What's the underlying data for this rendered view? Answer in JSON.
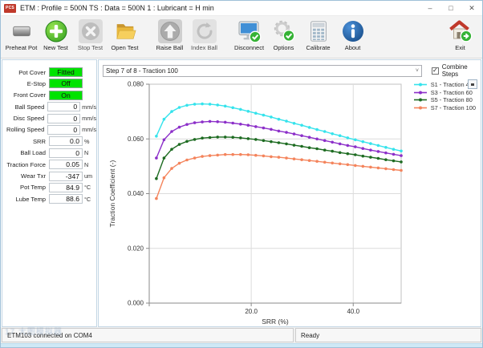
{
  "window": {
    "title": "ETM : Profile = 500N TS : Data = 500N 1 : Lubricant = H min",
    "app_icon_label": "PCS",
    "controls": {
      "minimize": "–",
      "maximize": "□",
      "close": "✕"
    }
  },
  "toolbar": {
    "buttons": [
      {
        "name": "preheat-pot",
        "label": "Preheat Pot",
        "icon": "preheat-pot-icon"
      },
      {
        "name": "new-test",
        "label": "New Test",
        "icon": "new-test-icon"
      },
      {
        "name": "stop-test",
        "label": "Stop Test",
        "icon": "stop-test-icon",
        "disabled": true
      },
      {
        "name": "open-test",
        "label": "Open Test",
        "icon": "open-test-icon"
      },
      {
        "name": "raise-ball",
        "label": "Raise Ball",
        "icon": "raise-ball-icon",
        "gap_before": true
      },
      {
        "name": "index-ball",
        "label": "Index Ball",
        "icon": "index-ball-icon",
        "disabled": true
      },
      {
        "name": "disconnect",
        "label": "Disconnect",
        "icon": "disconnect-icon",
        "gap_before": true
      },
      {
        "name": "options",
        "label": "Options",
        "icon": "options-icon"
      },
      {
        "name": "calibrate",
        "label": "Calibrate",
        "icon": "calibrate-icon"
      },
      {
        "name": "about",
        "label": "About",
        "icon": "about-icon"
      },
      {
        "name": "exit",
        "label": "Exit",
        "icon": "exit-icon",
        "align": "right"
      }
    ]
  },
  "status_panel": {
    "rows": [
      {
        "label": "Pot Cover",
        "value": "Fitted",
        "unit": "",
        "style": "green"
      },
      {
        "label": "E-Stop",
        "value": "Off",
        "unit": "",
        "style": "green"
      },
      {
        "label": "Front Cover",
        "value": "On",
        "unit": "",
        "style": "green"
      },
      {
        "label": "Ball Speed",
        "value": "0",
        "unit": "mm/s",
        "style": "plain"
      },
      {
        "label": "Disc Speed",
        "value": "0",
        "unit": "mm/s",
        "style": "plain"
      },
      {
        "label": "Rolling Speed",
        "value": "0",
        "unit": "mm/s",
        "style": "plain"
      },
      {
        "label": "SRR",
        "value": "0.0",
        "unit": "%",
        "style": "plain"
      },
      {
        "label": "Ball Load",
        "value": "0",
        "unit": "N",
        "style": "plain"
      },
      {
        "label": "Traction Force",
        "value": "0.05",
        "unit": "N",
        "style": "plain"
      },
      {
        "label": "Wear Txr",
        "value": "-347",
        "unit": "um",
        "style": "plain"
      },
      {
        "label": "Pot Temp",
        "value": "84.9",
        "unit": "°C",
        "style": "plain"
      },
      {
        "label": "Lube Temp",
        "value": "88.6",
        "unit": "°C",
        "style": "plain"
      }
    ]
  },
  "chart_panel": {
    "step_selector": "Step 7 of 8 - Traction 100",
    "combine_steps_label": "Combine Steps",
    "combine_steps_checked": true,
    "check_glyph": "✓",
    "chevron_glyph": "˅"
  },
  "chart_data": {
    "type": "line",
    "title": "",
    "xlabel": "SRR (%)",
    "ylabel": "Traction Coefficient (-)",
    "xlim": [
      0,
      49.4
    ],
    "ylim": [
      0,
      0.08
    ],
    "x_ticks": [
      0,
      20.0,
      40.0
    ],
    "x_tick_labels": [
      "",
      "20.0",
      "40.0"
    ],
    "y_ticks": [
      0.0,
      0.02,
      0.04,
      0.06,
      0.08
    ],
    "grid": true,
    "legend_position": "top-right-outside",
    "x": [
      1.4,
      2.9,
      4.4,
      5.9,
      7.4,
      8.9,
      10.4,
      11.9,
      13.4,
      14.9,
      16.4,
      17.9,
      19.4,
      20.9,
      22.4,
      23.9,
      25.4,
      26.9,
      28.4,
      29.9,
      31.4,
      32.9,
      34.4,
      35.9,
      37.4,
      38.9,
      40.4,
      41.9,
      43.4,
      44.9,
      46.4,
      47.9,
      49.4
    ],
    "series": [
      {
        "name": "S1 - Traction 40",
        "color": "#35e3ec",
        "values": [
          0.061,
          0.0672,
          0.07,
          0.0715,
          0.0723,
          0.0727,
          0.0728,
          0.0727,
          0.0724,
          0.072,
          0.0714,
          0.0708,
          0.0701,
          0.0694,
          0.0687,
          0.068,
          0.0672,
          0.0665,
          0.0657,
          0.065,
          0.0642,
          0.0634,
          0.0627,
          0.0619,
          0.0612,
          0.0604,
          0.0597,
          0.059,
          0.0583,
          0.0576,
          0.0569,
          0.0562,
          0.0556
        ]
      },
      {
        "name": "S3 - Traction 60",
        "color": "#8c2fc9",
        "values": [
          0.053,
          0.0597,
          0.0627,
          0.0643,
          0.0653,
          0.0659,
          0.0662,
          0.0664,
          0.0663,
          0.0661,
          0.0658,
          0.0654,
          0.065,
          0.0645,
          0.064,
          0.0635,
          0.0629,
          0.0624,
          0.0618,
          0.0612,
          0.0606,
          0.06,
          0.0594,
          0.0588,
          0.0582,
          0.0576,
          0.0571,
          0.0565,
          0.0559,
          0.0554,
          0.0549,
          0.0544,
          0.0539
        ]
      },
      {
        "name": "S5 - Traction 80",
        "color": "#1d6b21",
        "values": [
          0.0455,
          0.053,
          0.0562,
          0.058,
          0.0591,
          0.0598,
          0.0603,
          0.0605,
          0.0607,
          0.0607,
          0.0606,
          0.0604,
          0.0601,
          0.0598,
          0.0594,
          0.059,
          0.0586,
          0.0582,
          0.0577,
          0.0573,
          0.0568,
          0.0564,
          0.0559,
          0.0555,
          0.055,
          0.0546,
          0.0542,
          0.0537,
          0.0533,
          0.0529,
          0.0524,
          0.052,
          0.0516
        ]
      },
      {
        "name": "S7 - Traction 100",
        "color": "#f4845c",
        "values": [
          0.0382,
          0.0458,
          0.0492,
          0.0511,
          0.0523,
          0.053,
          0.0536,
          0.0539,
          0.0541,
          0.0543,
          0.0543,
          0.0543,
          0.0542,
          0.054,
          0.0538,
          0.0535,
          0.0533,
          0.053,
          0.0527,
          0.0524,
          0.0521,
          0.0518,
          0.0515,
          0.0512,
          0.0509,
          0.0506,
          0.0503,
          0.05,
          0.0497,
          0.0494,
          0.0491,
          0.0488,
          0.0485
        ]
      }
    ]
  },
  "status_bar": {
    "connection": "ETM103 connected on COM4",
    "state": "Ready"
  },
  "watermark": {
    "text": "17 大图模拟器"
  }
}
